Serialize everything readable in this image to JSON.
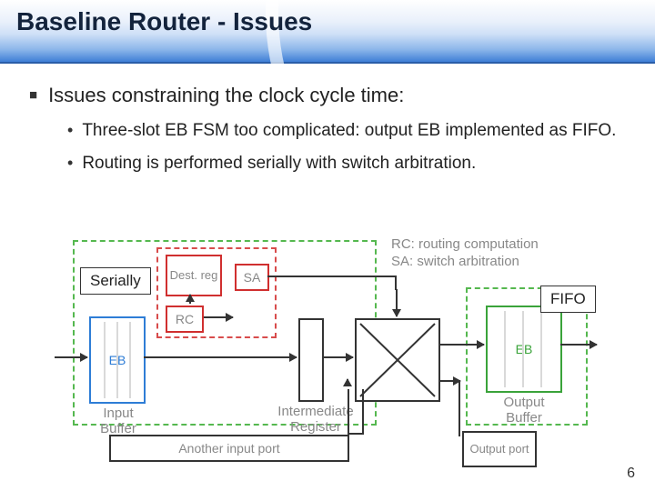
{
  "title": "Baseline Router - Issues",
  "bullets": {
    "main": "Issues constraining the clock cycle time:",
    "sub1": "Three-slot EB FSM too complicated: output EB implemented as FIFO.",
    "sub2": "Routing is performed serially with switch arbitration."
  },
  "callouts": {
    "serially": "Serially",
    "fifo": "FIFO"
  },
  "legend": {
    "rc": "RC: routing computation",
    "sa": "SA: switch arbitration"
  },
  "diagram": {
    "eb": "EB",
    "input_buffer": "Input Buffer",
    "dest_reg": "Dest. reg",
    "rc_box": "RC",
    "sa_box": "SA",
    "intermediate": "Intermediate Register",
    "eb_out": "EB",
    "output_buffer": "Output Buffer",
    "another_port": "Another input port",
    "output_port": "Output port"
  },
  "page": "6"
}
